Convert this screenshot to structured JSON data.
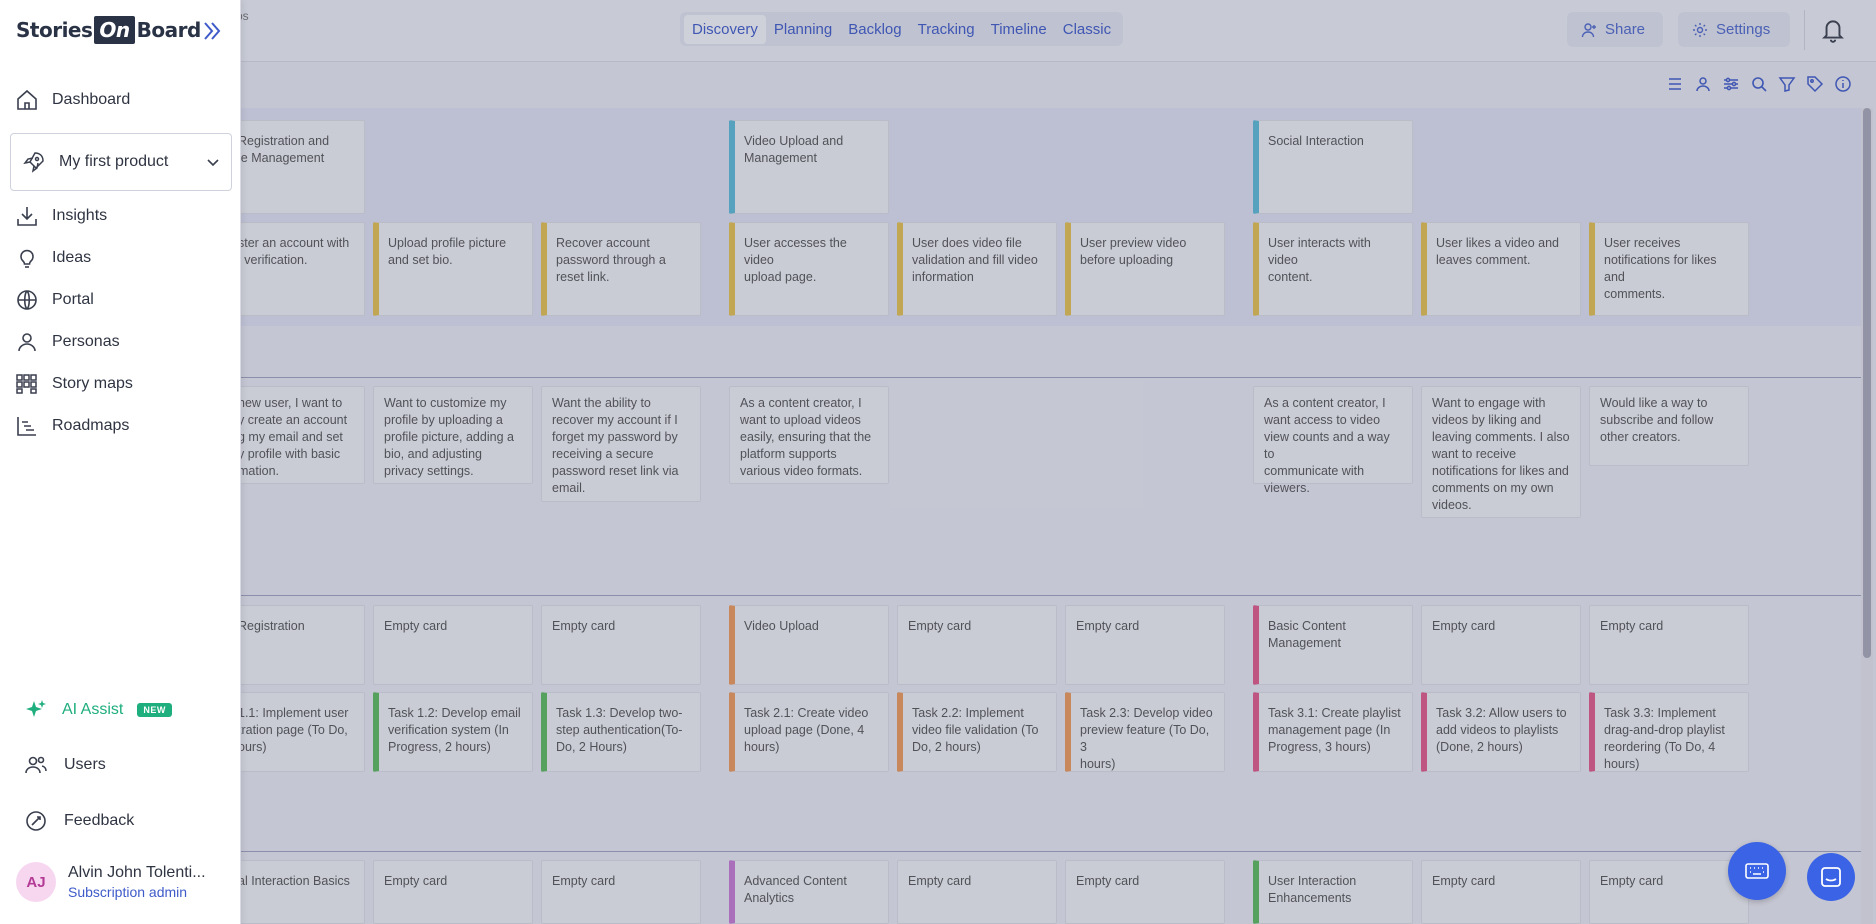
{
  "header": {
    "breadcrumb_fragment": "ps",
    "tabs": [
      {
        "label": "Discovery",
        "active": true
      },
      {
        "label": "Planning"
      },
      {
        "label": "Backlog"
      },
      {
        "label": "Tracking"
      },
      {
        "label": "Timeline"
      },
      {
        "label": "Classic"
      }
    ],
    "share_label": "Share",
    "settings_label": "Settings"
  },
  "board": {
    "activities": [
      {
        "text": "Registration and\nle Management"
      },
      {
        "text": "Video Upload and\nManagement"
      },
      {
        "text": "Social Interaction"
      }
    ],
    "steps": [
      {
        "text": "ster an account with\nl verification."
      },
      {
        "text": "Upload profile picture\nand set bio."
      },
      {
        "text": "Recover account\npassword through a\nreset link."
      },
      {
        "text": "User accesses the video\nupload page."
      },
      {
        "text": "User does video file\nvalidation and fill video\ninformation"
      },
      {
        "text": "User preview video\nbefore uploading"
      },
      {
        "text": "User interacts with video\ncontent."
      },
      {
        "text": "User likes a video and\nleaves comment."
      },
      {
        "text": "User receives\nnotifications for likes and\ncomments."
      }
    ],
    "notes": [
      {
        "text": "new user, I want to\ny create an account\ng my email and set\ny profile with basic\nmation."
      },
      {
        "text": "Want to customize my\nprofile by uploading a\nprofile picture, adding a\nbio, and adjusting\nprivacy settings."
      },
      {
        "text": "Want the ability to\nrecover my account if I\nforget my password by\nreceiving a secure\npassword reset link via\nemail."
      },
      {
        "text": "As a content creator, I\nwant to upload videos\neasily, ensuring that the\nplatform supports\nvarious video formats."
      },
      {
        "text": "As a content creator, I\nwant access to video\nview counts and a way to\ncommunicate with\nviewers."
      },
      {
        "text": "Want to engage with\nvideos by liking and\nleaving comments. I also\nwant to receive\nnotifications for likes and\ncomments on my own\nvideos."
      },
      {
        "text": "Would like a way to\nsubscribe and follow\nother creators."
      }
    ],
    "release1_headers": [
      {
        "text": "Registration"
      },
      {
        "text": "Empty card"
      },
      {
        "text": "Empty card"
      },
      {
        "text": "Video Upload"
      },
      {
        "text": "Empty card"
      },
      {
        "text": "Empty card"
      },
      {
        "text": "Basic Content\nManagement"
      },
      {
        "text": "Empty card"
      },
      {
        "text": "Empty card"
      }
    ],
    "release1_tasks": [
      {
        "text": "1.1: Implement user\ntration page (To Do,\nours)"
      },
      {
        "text": "Task 1.2: Develop email\nverification system (In\nProgress, 2 hours)"
      },
      {
        "text": "Task 1.3: Develop two-\nstep authentication(To-\nDo, 2 Hours)"
      },
      {
        "text": "Task 2.1: Create video\nupload page (Done, 4\nhours)"
      },
      {
        "text": "Task 2.2: Implement\nvideo file validation (To\nDo, 2 hours)"
      },
      {
        "text": "Task 2.3: Develop video\npreview feature (To Do, 3\nhours)"
      },
      {
        "text": "Task 3.1: Create playlist\nmanagement page (In\nProgress, 3 hours)"
      },
      {
        "text": "Task 3.2: Allow users to\nadd videos to playlists\n(Done, 2 hours)"
      },
      {
        "text": "Task 3.3: Implement\ndrag-and-drop playlist\nreordering (To Do, 4\nhours)"
      }
    ],
    "release2_headers": [
      {
        "text": "al Interaction Basics"
      },
      {
        "text": "Empty card"
      },
      {
        "text": "Empty card"
      },
      {
        "text": "Advanced Content\nAnalytics"
      },
      {
        "text": "Empty card"
      },
      {
        "text": "Empty card"
      },
      {
        "text": "User Interaction\nEnhancements"
      },
      {
        "text": "Empty card"
      },
      {
        "text": "Empty card"
      }
    ]
  },
  "colors": {
    "activity_blue": "#5bbbd8",
    "step_yellow": "#e4c24f",
    "task_green": "#5cba5c",
    "task_orange": "#ee9a5a",
    "task_pink": "#e05a8a",
    "task_purple": "#c77ad2",
    "accent": "#3e5bc9",
    "ai_green": "#1fae7d"
  },
  "sidebar": {
    "logo": {
      "left": "Stories",
      "mid": "On",
      "right": "Board"
    },
    "items_top": [
      {
        "label": "Dashboard",
        "icon": "home-icon"
      }
    ],
    "product": {
      "label": "My first product"
    },
    "items": [
      {
        "label": "Insights",
        "icon": "download-icon"
      },
      {
        "label": "Ideas",
        "icon": "lightbulb-icon"
      },
      {
        "label": "Portal",
        "icon": "globe-icon"
      },
      {
        "label": "Personas",
        "icon": "person-icon"
      },
      {
        "label": "Story maps",
        "icon": "storymap-icon"
      },
      {
        "label": "Roadmaps",
        "icon": "roadmap-icon"
      }
    ],
    "ai": {
      "label": "AI Assist",
      "badge": "NEW"
    },
    "users_label": "Users",
    "feedback_label": "Feedback",
    "user": {
      "initials": "AJ",
      "name": "Alvin John Tolenti...",
      "role": "Subscription admin"
    }
  }
}
